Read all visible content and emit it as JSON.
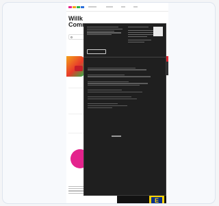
{
  "hero": {
    "title": "Willk\nComm",
    "subtitle": ""
  },
  "search": {
    "placeholder": ""
  },
  "consent": {
    "left_heading": "",
    "right_heading": "",
    "section_title": "",
    "accept_label": "",
    "close_label": ""
  },
  "edeka": {
    "logo_text": "E"
  },
  "colors": {
    "modal_bg": "#1f1f1f",
    "accent_pink": "#e4238d",
    "accent_teal": "#17b59a",
    "edeka_yellow": "#ffd200",
    "edeka_blue": "#0a2f8a"
  }
}
